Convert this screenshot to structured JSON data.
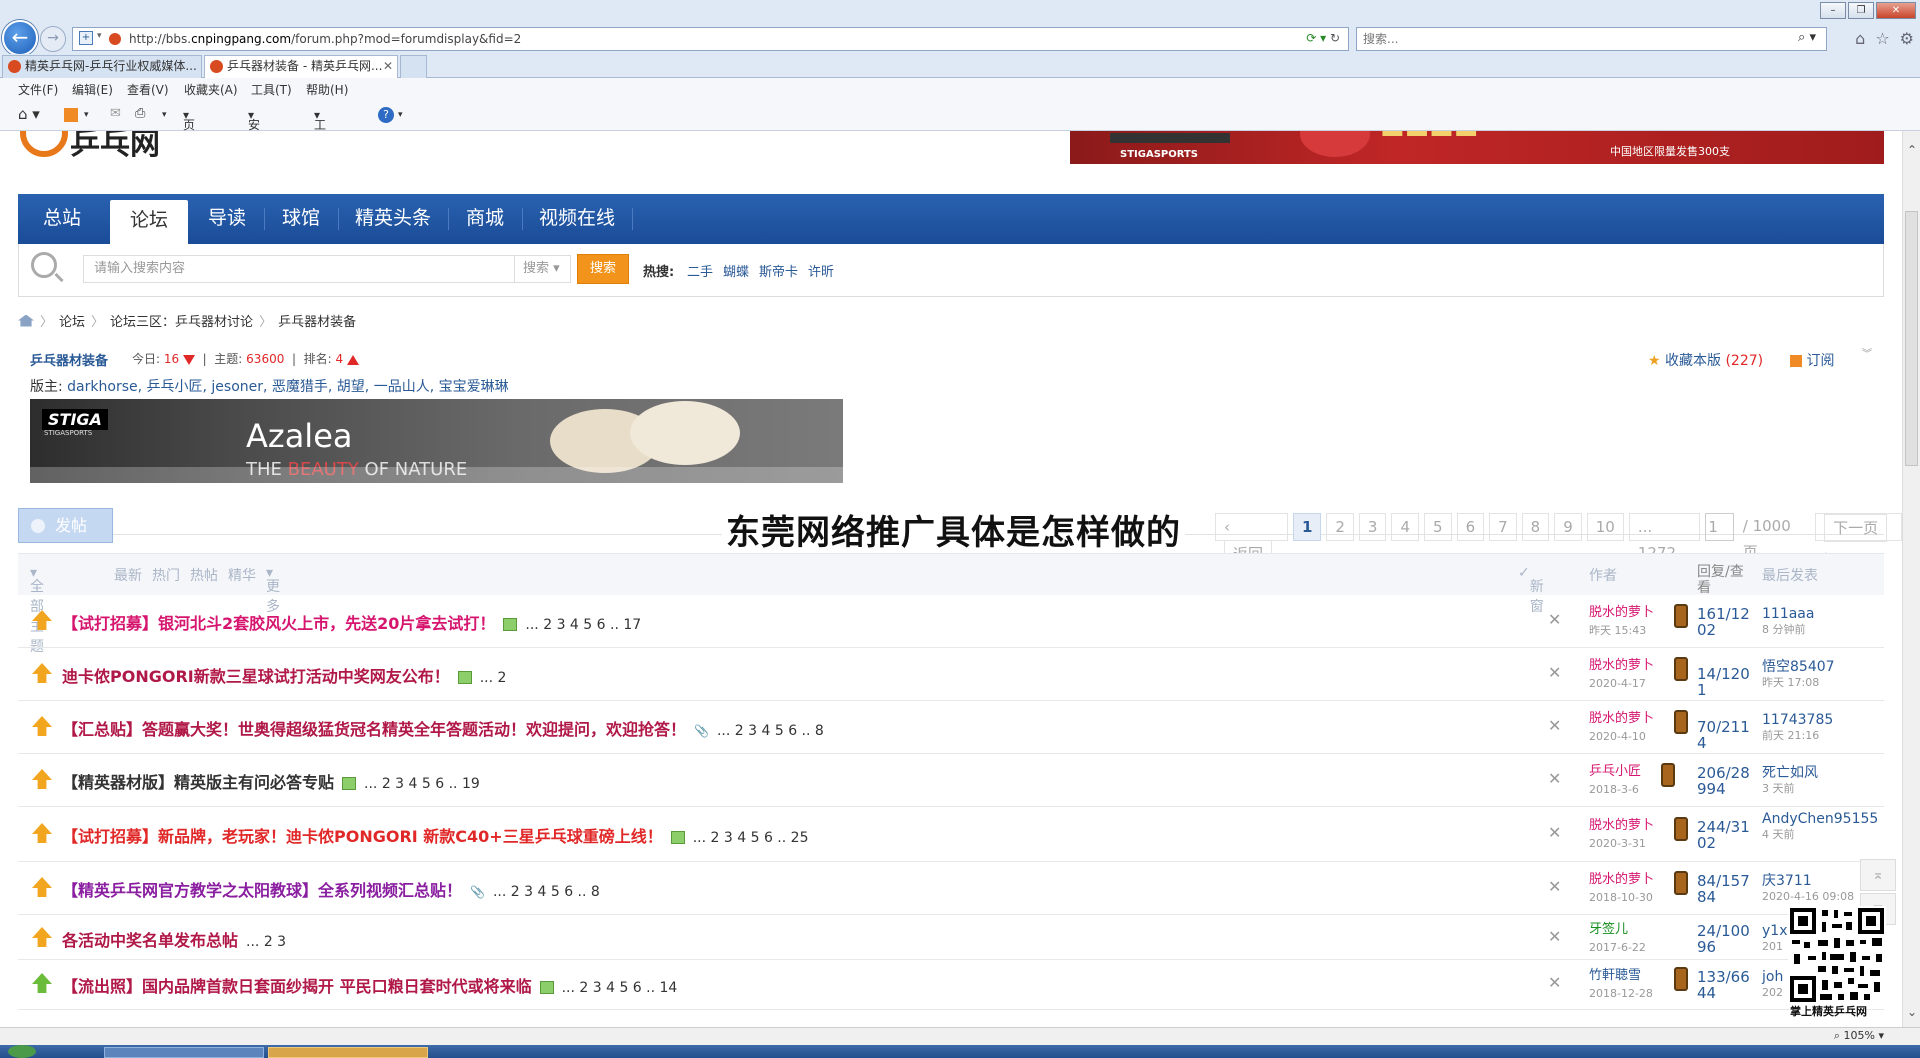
{
  "browser": {
    "url_prefix": "http://bbs.",
    "url_domain": "cnpingpang.com",
    "url_path": "/forum.php?mod=forumdisplay&fid=2",
    "search_placeholder": "搜索...",
    "tabs": [
      {
        "label": "精英乒乓网-乒乓行业权威媒体..."
      },
      {
        "label": "乒乓器材装备 - 精英乒乓网..."
      }
    ],
    "menu": [
      "文件(F)",
      "编辑(E)",
      "查看(V)",
      "收藏夹(A)",
      "工具(T)",
      "帮助(H)"
    ],
    "commands": [
      "页面(P)",
      "安全(S)",
      "工具(O)"
    ],
    "zoom": "105%"
  },
  "site": {
    "banner_top_text": "中国地区限量发售300支",
    "banner_top_brand": "STIGASPORTS",
    "nav": [
      "总站",
      "论坛",
      "导读",
      "球馆",
      "精英头条",
      "商城",
      "视频在线"
    ],
    "active_nav": "论坛",
    "search": {
      "placeholder": "请输入搜索内容",
      "select": "搜索",
      "button": "搜索",
      "hot_label": "热搜:",
      "hot_links": [
        "二手",
        "蝴蝶",
        "斯帝卡",
        "许昕"
      ]
    },
    "breadcrumb": [
      "论坛",
      "论坛三区：乒乓器材讨论",
      "乒乓器材装备"
    ]
  },
  "forum": {
    "name": "乒乓器材装备",
    "today_label": "今日:",
    "today": "16",
    "topics_label": "主题:",
    "topics": "63600",
    "rank_label": "排名:",
    "rank": "4",
    "moderators_label": "版主:",
    "moderators": "darkhorse, 乒乓小匠, jesoner, 恶魔猎手, 胡望, 一品山人, 宝宝爱琳琳",
    "favorite_label": "收藏本版",
    "favorite_count": "(227)",
    "subscribe_label": "订阅",
    "banner": {
      "brand": "STIGA",
      "brand_sub": "STIGASPORTS",
      "title": "Azalea",
      "tagline_a": "THE ",
      "tagline_b": "BEAUTY",
      "tagline_c": " OF NATURE"
    }
  },
  "overlay_title": "东莞网络推广具体是怎样做的",
  "post_button": "发帖",
  "pager": {
    "back": "返回",
    "pages": [
      "1",
      "2",
      "3",
      "4",
      "5",
      "6",
      "7",
      "8",
      "9",
      "10"
    ],
    "last": "... 1272",
    "input_value": "1",
    "total": "/ 1000 页",
    "next": "下一页"
  },
  "filters": {
    "all": "全部主题",
    "items": [
      "最新",
      "热门",
      "热帖",
      "精华",
      "更多"
    ],
    "new_window": "新窗",
    "author": "作者",
    "reply_view": "回复/查看",
    "last_post": "最后发表"
  },
  "threads": [
    {
      "title": "【试打招募】银河北斗2套胶风火上市，先送20片拿去试打！",
      "pages": "... 2 3 4 5 6 .. 17",
      "author": "脱水的萝卜",
      "date": "昨天 15:43",
      "replies": "161/1202",
      "last_user": "111aaa",
      "last_time": "8 分钟前"
    },
    {
      "title": "迪卡侬PONGORI新款三星球试打活动中奖网友公布！",
      "pages": "... 2",
      "author": "脱水的萝卜",
      "date": "2020-4-17",
      "replies": "14/1201",
      "last_user": "悟空85407",
      "last_time": "昨天 17:08"
    },
    {
      "title": "【汇总贴】答题赢大奖！世奥得超级猛货冠名精英全年答题活动！欢迎提问，欢迎抢答！",
      "pages": "... 2 3 4 5 6 .. 8",
      "author": "脱水的萝卜",
      "date": "2020-4-10",
      "replies": "70/2114",
      "last_user": "11743785",
      "last_time": "前天 21:16"
    },
    {
      "title": "【精英器材版】精英版主有问必答专贴",
      "pages": "... 2 3 4 5 6 .. 19",
      "author": "乒乓小匠",
      "date": "2018-3-6",
      "replies": "206/28994",
      "last_user": "死亡如风",
      "last_time": "3 天前"
    },
    {
      "title": "【试打招募】新品牌，老玩家！迪卡侬PONGORI 新款C40+三星乒乓球重磅上线！",
      "pages": "... 2 3 4 5 6 .. 25",
      "author": "脱水的萝卜",
      "date": "2020-3-31",
      "replies": "244/3102",
      "last_user": "AndyChen95155",
      "last_time": "4 天前"
    },
    {
      "title": "【精英乒乓网官方教学之太阳教球】全系列视频汇总贴！",
      "pages": "... 2 3 4 5 6 .. 8",
      "author": "脱水的萝卜",
      "date": "2018-10-30",
      "replies": "84/15784",
      "last_user": "庆3711",
      "last_time": "2020-4-16 09:08"
    },
    {
      "title": "各活动中奖名单发布总帖",
      "pages": "... 2 3",
      "author": "牙签儿",
      "date": "2017-6-22",
      "replies": "24/10096",
      "last_user": "y1x",
      "last_time": "201"
    },
    {
      "title": "【流出照】国内品牌首款日套面纱揭开 平民口粮日套时代或将来临",
      "pages": "... 2 3 4 5 6 .. 14",
      "author": "竹軒聴雪",
      "date": "2018-12-28",
      "replies": "133/6644",
      "last_user": "joh",
      "last_time": "202"
    }
  ],
  "qr_label": "掌上精英乒乓网"
}
